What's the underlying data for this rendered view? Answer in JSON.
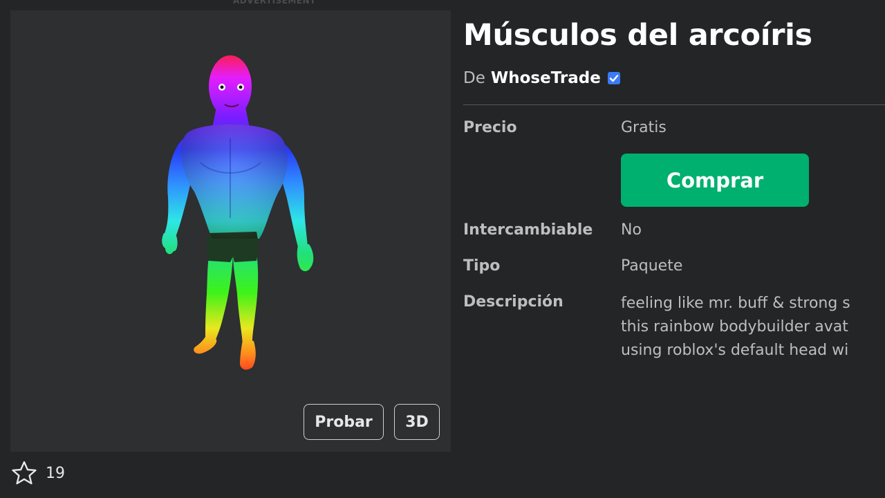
{
  "ad_label": "ADVERTISEMENT",
  "item": {
    "title": "Músculos del arcoíris",
    "creator_prefix": "De",
    "creator_name": "WhoseTrade"
  },
  "thumbnail": {
    "try_label": "Probar",
    "view3d_label": "3D"
  },
  "favorites": {
    "count": "19"
  },
  "details": {
    "price_label": "Precio",
    "price_value": "Gratis",
    "buy_label": "Comprar",
    "tradable_label": "Intercambiable",
    "tradable_value": "No",
    "type_label": "Tipo",
    "type_value": "Paquete",
    "description_label": "Descripción",
    "description_lines": [
      "feeling like mr. buff & strong s",
      "this rainbow bodybuilder avat",
      "using roblox's default head wi"
    ]
  },
  "colors": {
    "background": "#232527",
    "panel": "#2d2f31",
    "buy_button": "#00b06f",
    "verified_badge": "#3a7bf7"
  },
  "icons": {
    "favorite": "star-outline-icon",
    "verified": "verified-badge-icon"
  }
}
